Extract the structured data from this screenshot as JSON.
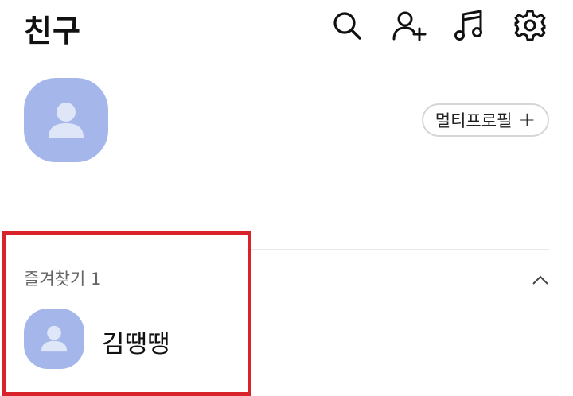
{
  "header": {
    "title": "친구",
    "icons": [
      "search-icon",
      "add-friend-icon",
      "music-icon",
      "settings-icon"
    ]
  },
  "my_profile": {
    "avatar_icon": "person-icon",
    "multi_profile_label": "멀티프로필",
    "multi_profile_plus": "+"
  },
  "favorites": {
    "section_title": "즐겨찾기 1",
    "collapse_icon": "chevron-up-icon",
    "friends": [
      {
        "name": "김땡땡",
        "avatar_icon": "person-icon"
      }
    ]
  },
  "colors": {
    "avatar_bg": "#a5b7ea",
    "avatar_person": "#dfe6f8",
    "highlight": "#d9232b"
  }
}
